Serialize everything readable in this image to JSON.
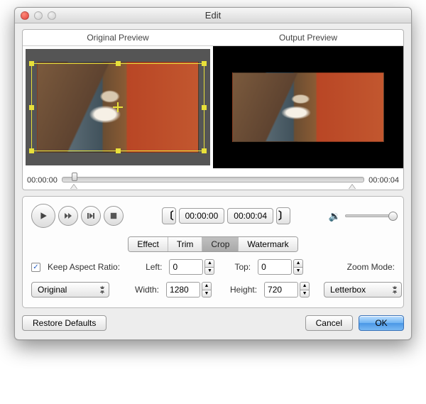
{
  "window": {
    "title": "Edit"
  },
  "previews": {
    "left_header": "Original Preview",
    "right_header": "Output Preview"
  },
  "timeline": {
    "start": "00:00:00",
    "end": "00:00:04"
  },
  "transport": {
    "in_time": "00:00:00",
    "out_time": "00:00:04",
    "bracket_open": "〔",
    "bracket_close": "〕"
  },
  "tabs": {
    "effect": "Effect",
    "trim": "Trim",
    "crop": "Crop",
    "watermark": "Watermark"
  },
  "crop": {
    "keep_aspect_label": "Keep Aspect Ratio:",
    "keep_aspect_checked": "✓",
    "left_label": "Left:",
    "left_value": "0",
    "top_label": "Top:",
    "top_value": "0",
    "zoom_mode_label": "Zoom Mode:",
    "aspect_select": "Original",
    "width_label": "Width:",
    "width_value": "1280",
    "height_label": "Height:",
    "height_value": "720",
    "zoom_select": "Letterbox"
  },
  "footer": {
    "restore": "Restore Defaults",
    "cancel": "Cancel",
    "ok": "OK"
  }
}
